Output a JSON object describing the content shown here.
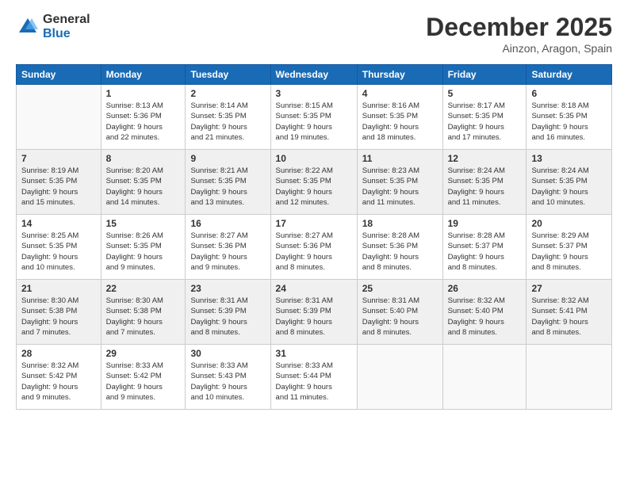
{
  "logo": {
    "general": "General",
    "blue": "Blue"
  },
  "title": "December 2025",
  "location": "Ainzon, Aragon, Spain",
  "days_header": [
    "Sunday",
    "Monday",
    "Tuesday",
    "Wednesday",
    "Thursday",
    "Friday",
    "Saturday"
  ],
  "weeks": [
    [
      {
        "day": "",
        "info": ""
      },
      {
        "day": "1",
        "info": "Sunrise: 8:13 AM\nSunset: 5:36 PM\nDaylight: 9 hours\nand 22 minutes."
      },
      {
        "day": "2",
        "info": "Sunrise: 8:14 AM\nSunset: 5:35 PM\nDaylight: 9 hours\nand 21 minutes."
      },
      {
        "day": "3",
        "info": "Sunrise: 8:15 AM\nSunset: 5:35 PM\nDaylight: 9 hours\nand 19 minutes."
      },
      {
        "day": "4",
        "info": "Sunrise: 8:16 AM\nSunset: 5:35 PM\nDaylight: 9 hours\nand 18 minutes."
      },
      {
        "day": "5",
        "info": "Sunrise: 8:17 AM\nSunset: 5:35 PM\nDaylight: 9 hours\nand 17 minutes."
      },
      {
        "day": "6",
        "info": "Sunrise: 8:18 AM\nSunset: 5:35 PM\nDaylight: 9 hours\nand 16 minutes."
      }
    ],
    [
      {
        "day": "7",
        "info": "Sunrise: 8:19 AM\nSunset: 5:35 PM\nDaylight: 9 hours\nand 15 minutes."
      },
      {
        "day": "8",
        "info": "Sunrise: 8:20 AM\nSunset: 5:35 PM\nDaylight: 9 hours\nand 14 minutes."
      },
      {
        "day": "9",
        "info": "Sunrise: 8:21 AM\nSunset: 5:35 PM\nDaylight: 9 hours\nand 13 minutes."
      },
      {
        "day": "10",
        "info": "Sunrise: 8:22 AM\nSunset: 5:35 PM\nDaylight: 9 hours\nand 12 minutes."
      },
      {
        "day": "11",
        "info": "Sunrise: 8:23 AM\nSunset: 5:35 PM\nDaylight: 9 hours\nand 11 minutes."
      },
      {
        "day": "12",
        "info": "Sunrise: 8:24 AM\nSunset: 5:35 PM\nDaylight: 9 hours\nand 11 minutes."
      },
      {
        "day": "13",
        "info": "Sunrise: 8:24 AM\nSunset: 5:35 PM\nDaylight: 9 hours\nand 10 minutes."
      }
    ],
    [
      {
        "day": "14",
        "info": "Sunrise: 8:25 AM\nSunset: 5:35 PM\nDaylight: 9 hours\nand 10 minutes."
      },
      {
        "day": "15",
        "info": "Sunrise: 8:26 AM\nSunset: 5:35 PM\nDaylight: 9 hours\nand 9 minutes."
      },
      {
        "day": "16",
        "info": "Sunrise: 8:27 AM\nSunset: 5:36 PM\nDaylight: 9 hours\nand 9 minutes."
      },
      {
        "day": "17",
        "info": "Sunrise: 8:27 AM\nSunset: 5:36 PM\nDaylight: 9 hours\nand 8 minutes."
      },
      {
        "day": "18",
        "info": "Sunrise: 8:28 AM\nSunset: 5:36 PM\nDaylight: 9 hours\nand 8 minutes."
      },
      {
        "day": "19",
        "info": "Sunrise: 8:28 AM\nSunset: 5:37 PM\nDaylight: 9 hours\nand 8 minutes."
      },
      {
        "day": "20",
        "info": "Sunrise: 8:29 AM\nSunset: 5:37 PM\nDaylight: 9 hours\nand 8 minutes."
      }
    ],
    [
      {
        "day": "21",
        "info": "Sunrise: 8:30 AM\nSunset: 5:38 PM\nDaylight: 9 hours\nand 7 minutes."
      },
      {
        "day": "22",
        "info": "Sunrise: 8:30 AM\nSunset: 5:38 PM\nDaylight: 9 hours\nand 7 minutes."
      },
      {
        "day": "23",
        "info": "Sunrise: 8:31 AM\nSunset: 5:39 PM\nDaylight: 9 hours\nand 8 minutes."
      },
      {
        "day": "24",
        "info": "Sunrise: 8:31 AM\nSunset: 5:39 PM\nDaylight: 9 hours\nand 8 minutes."
      },
      {
        "day": "25",
        "info": "Sunrise: 8:31 AM\nSunset: 5:40 PM\nDaylight: 9 hours\nand 8 minutes."
      },
      {
        "day": "26",
        "info": "Sunrise: 8:32 AM\nSunset: 5:40 PM\nDaylight: 9 hours\nand 8 minutes."
      },
      {
        "day": "27",
        "info": "Sunrise: 8:32 AM\nSunset: 5:41 PM\nDaylight: 9 hours\nand 8 minutes."
      }
    ],
    [
      {
        "day": "28",
        "info": "Sunrise: 8:32 AM\nSunset: 5:42 PM\nDaylight: 9 hours\nand 9 minutes."
      },
      {
        "day": "29",
        "info": "Sunrise: 8:33 AM\nSunset: 5:42 PM\nDaylight: 9 hours\nand 9 minutes."
      },
      {
        "day": "30",
        "info": "Sunrise: 8:33 AM\nSunset: 5:43 PM\nDaylight: 9 hours\nand 10 minutes."
      },
      {
        "day": "31",
        "info": "Sunrise: 8:33 AM\nSunset: 5:44 PM\nDaylight: 9 hours\nand 11 minutes."
      },
      {
        "day": "",
        "info": ""
      },
      {
        "day": "",
        "info": ""
      },
      {
        "day": "",
        "info": ""
      }
    ]
  ]
}
